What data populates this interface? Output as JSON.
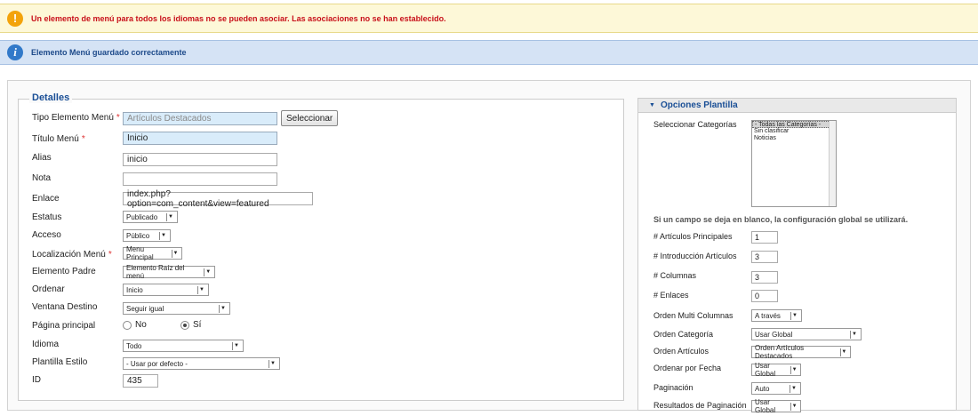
{
  "messages": {
    "warning": "Un elemento de menú para todos los idiomas no se pueden asociar. Las asociaciones no se han establecido.",
    "info": "Elemento Menú guardado correctamente",
    "warning_icon": "!",
    "info_icon": "i"
  },
  "details": {
    "legend": "Detalles",
    "tipo_label": "Tipo Elemento Menú",
    "tipo_value": "Artículos Destacados",
    "select_button": "Seleccionar",
    "titulo_label": "Título Menú",
    "titulo_value": "Inicio",
    "alias_label": "Alias",
    "alias_value": "inicio",
    "nota_label": "Nota",
    "nota_value": "",
    "enlace_label": "Enlace",
    "enlace_value": "index.php?option=com_content&view=featured",
    "estatus_label": "Estatus",
    "estatus_value": "Publicado",
    "acceso_label": "Acceso",
    "acceso_value": "Público",
    "localizacion_label": "Localización Menú",
    "localizacion_value": "Menu Principal",
    "padre_label": "Elemento Padre",
    "padre_value": "Elemento Raíz del menú",
    "ordenar_label": "Ordenar",
    "ordenar_value": "Inicio",
    "ventana_label": "Ventana Destino",
    "ventana_value": "Seguir igual",
    "pagina_label": "Página principal",
    "pagina_no": "No",
    "pagina_si": "Sí",
    "idioma_label": "Idioma",
    "idioma_value": "Todo",
    "plantilla_label": "Plantilla Estilo",
    "plantilla_value": "- Usar por defecto -",
    "id_label": "ID",
    "id_value": "435",
    "required_mark": "*"
  },
  "template_options": {
    "header": "Opciones Plantilla",
    "categorias_label": "Seleccionar Categorías",
    "categorias_options": [
      "- Todas las Categorías -",
      "Sin clasificar",
      "Noticias"
    ],
    "note": "Si un campo se deja en blanco, la configuración global se utilizará.",
    "principales_label": "# Artículos Principales",
    "principales_value": "1",
    "introduccion_label": "# Introducción Artículos",
    "introduccion_value": "3",
    "columnas_label": "# Columnas",
    "columnas_value": "3",
    "enlaces_label": "# Enlaces",
    "enlaces_value": "0",
    "multi_label": "Orden Multi Columnas",
    "multi_value": "A través",
    "categoria_label": "Orden Categoría",
    "categoria_value": "Usar Global",
    "articulos_label": "Orden Artículos",
    "articulos_value": "Orden Artículos Destacados",
    "fecha_label": "Ordenar por Fecha",
    "fecha_value": "Usar Global",
    "paginacion_label": "Paginación",
    "paginacion_value": "Auto",
    "resultados_label": "Resultados de Paginación",
    "resultados_value": "Usar Global"
  },
  "icons": {
    "warning": "warning-icon",
    "info": "info-icon",
    "dropdown": "chevron-down-icon",
    "collapse": "caret-down-icon"
  },
  "colors": {
    "warning_bg": "#fdf8d8",
    "warning_text": "#c8101a",
    "info_bg": "#d5e3f5",
    "accent": "#1a4f96"
  }
}
